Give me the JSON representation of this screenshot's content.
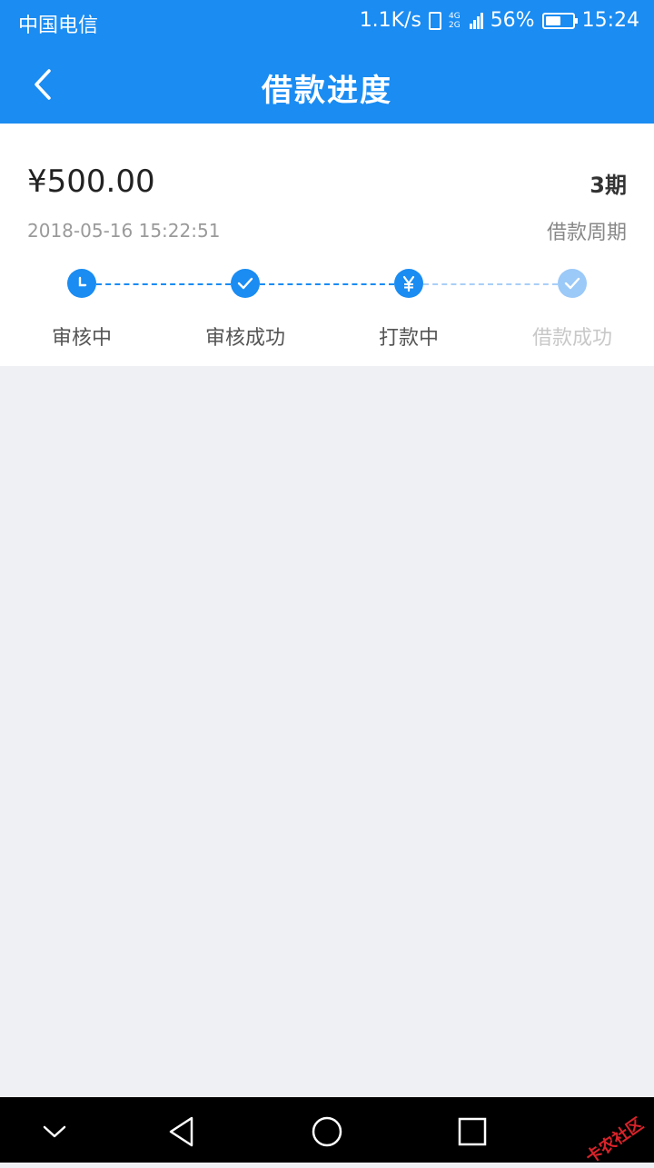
{
  "status_bar": {
    "carrier": "中国电信",
    "network_speed": "1.1K/s",
    "network_type_top": "4G",
    "network_type_bottom": "2G",
    "battery_percent": "56%",
    "battery_level": 0.56,
    "time": "15:24"
  },
  "app_bar": {
    "title": "借款进度",
    "back_icon": "chevron-left-icon"
  },
  "loan": {
    "amount": "¥500.00",
    "datetime": "2018-05-16 15:22:51",
    "period": "3期",
    "period_label": "借款周期"
  },
  "progress": {
    "steps": [
      {
        "label": "审核中",
        "icon": "clock-icon",
        "state": "done"
      },
      {
        "label": "审核成功",
        "icon": "check-icon",
        "state": "done"
      },
      {
        "label": "打款中",
        "icon": "yen-icon",
        "state": "current"
      },
      {
        "label": "借款成功",
        "icon": "check-icon",
        "state": "pending"
      }
    ]
  },
  "nav_bar": {
    "buttons": [
      "chevron-down-icon",
      "back-triangle-icon",
      "home-circle-icon",
      "recents-square-icon"
    ]
  },
  "watermark": "卡农社区",
  "colors": {
    "primary": "#1a8cf2",
    "primary_light": "#9bc9f8",
    "background": "#eff0f4"
  }
}
